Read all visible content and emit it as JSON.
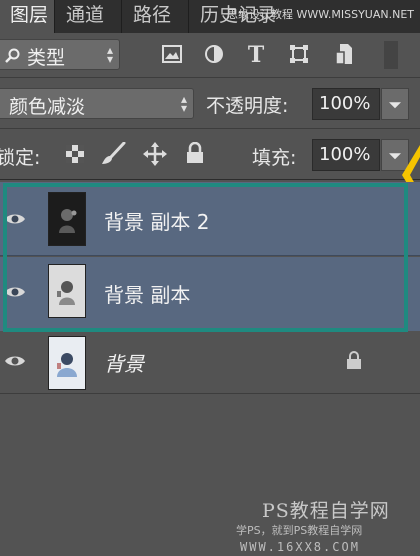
{
  "tabs": [
    {
      "label": "图层",
      "active": true
    },
    {
      "label": "通道",
      "active": false
    },
    {
      "label": "路径",
      "active": false
    },
    {
      "label": "历史记录",
      "active": false
    }
  ],
  "watermark_top": "思缘设计教程 WWW.MISSYUAN.NET",
  "filter": {
    "label": "类型",
    "search_icon": "search-icon"
  },
  "filter_icons": [
    "image-filter-icon",
    "adjustment-filter-icon",
    "type-filter-icon",
    "shape-filter-icon",
    "smart-object-filter-icon"
  ],
  "blend": {
    "mode": "颜色减淡",
    "opacity_label": "不透明度:",
    "opacity_value": "100%"
  },
  "lock": {
    "label": "锁定:",
    "fill_label": "填充:",
    "fill_value": "100%",
    "icons": [
      "lock-transparent-pixels-icon",
      "lock-image-pixels-icon",
      "lock-position-icon",
      "lock-all-icon"
    ]
  },
  "layers": [
    {
      "name": "背景 副本 2",
      "selected": true,
      "italic": false,
      "locked": false
    },
    {
      "name": "背景 副本",
      "selected": true,
      "italic": false,
      "locked": false
    },
    {
      "name": "背景",
      "selected": false,
      "italic": true,
      "locked": true
    }
  ],
  "colors": {
    "selected_row": "#586880",
    "highlight_box": "#1f8a80",
    "arrow": "#f5c400",
    "panel": "#535353"
  },
  "watermark_bottom": {
    "line1": "PS教程自学网",
    "line2": "学PS，就到PS教程自学网",
    "line3": "WWW.16XX8.COM"
  }
}
